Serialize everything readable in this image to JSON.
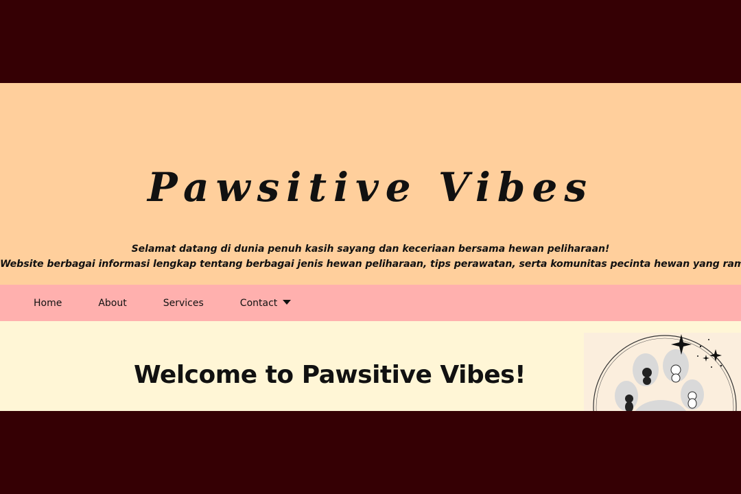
{
  "header": {
    "site_title": "Pawsitive Vibes",
    "tagline_line1": "Selamat datang di dunia penuh kasih sayang dan keceriaan bersama hewan peliharaan!",
    "tagline_line2": "Website berbagai informasi lengkap tentang berbagai jenis hewan peliharaan, tips perawatan, serta komunitas pecinta hewan yang ramah."
  },
  "nav": {
    "items": [
      {
        "label": "Home"
      },
      {
        "label": "About"
      },
      {
        "label": "Services"
      },
      {
        "label": "Contact",
        "has_dropdown": true
      }
    ]
  },
  "main": {
    "heading": "Welcome to Pawsitive Vibes!",
    "illustration": "paw-print-with-puppies-illustration"
  },
  "colors": {
    "page_backdrop": "#350004",
    "hero_bg": "#ffcf9c",
    "nav_bg": "#ffb0ae",
    "content_bg": "#fff6d6",
    "text": "#111111"
  }
}
